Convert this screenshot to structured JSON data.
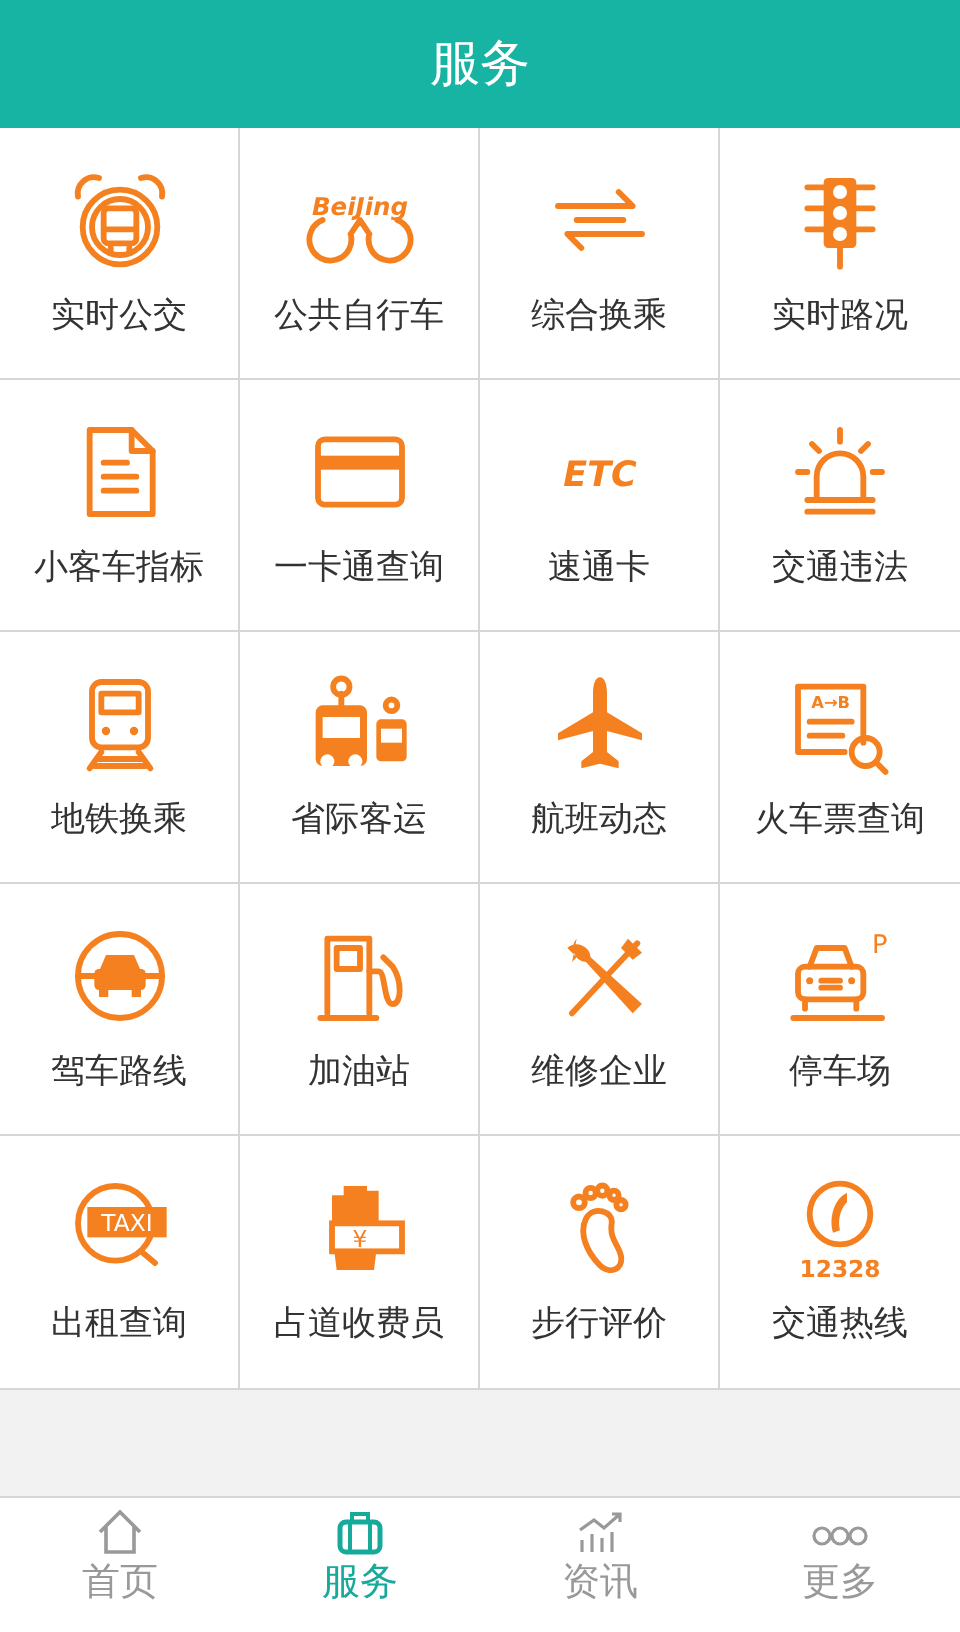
{
  "header": {
    "title": "服务"
  },
  "services": [
    {
      "label": "实时公交"
    },
    {
      "label": "公共自行车",
      "icon_text": "BeiJing"
    },
    {
      "label": "综合换乘"
    },
    {
      "label": "实时路况"
    },
    {
      "label": "小客车指标"
    },
    {
      "label": "一卡通查询"
    },
    {
      "label": "速通卡",
      "icon_text": "ETC"
    },
    {
      "label": "交通违法"
    },
    {
      "label": "地铁换乘"
    },
    {
      "label": "省际客运"
    },
    {
      "label": "航班动态"
    },
    {
      "label": "火车票查询",
      "icon_text": "A→B"
    },
    {
      "label": "驾车路线"
    },
    {
      "label": "加油站"
    },
    {
      "label": "维修企业"
    },
    {
      "label": "停车场",
      "icon_text": "P"
    },
    {
      "label": "出租查询",
      "icon_text": "TAXI"
    },
    {
      "label": "占道收费员",
      "icon_text": "¥"
    },
    {
      "label": "步行评价"
    },
    {
      "label": "交通热线",
      "icon_text": "12328"
    }
  ],
  "tab_bar": [
    {
      "label": "首页",
      "selected": false
    },
    {
      "label": "服务",
      "selected": true
    },
    {
      "label": "资讯",
      "selected": false
    },
    {
      "label": "更多",
      "selected": false
    }
  ]
}
